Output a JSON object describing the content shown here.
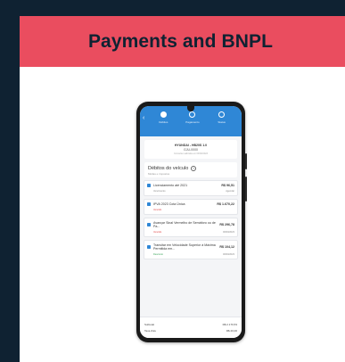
{
  "header": {
    "title": "Payments and BNPL"
  },
  "phone": {
    "steps": [
      {
        "label": "Débitos",
        "active": true
      },
      {
        "label": "Pagamento",
        "active": false
      },
      {
        "label": "Status",
        "active": false
      }
    ],
    "vehicle": {
      "name": "HYUNDAI - HB20S 1.0",
      "plate": "GJU-0000",
      "subtitle": "Consulta realizada em 00/00/2023"
    },
    "section": {
      "title": "Débitos do veículo",
      "subtitle": "Multas e impostos"
    },
    "debts": [
      {
        "title": "Licenciamento até 2021",
        "amount": "R$ 96,51",
        "meta_left": "Vencimento",
        "meta_left_color": "gray",
        "meta_right": "Agendar"
      },
      {
        "title": "IPVA 2023 Cota Única",
        "amount": "R$ 1.670,22",
        "meta_left": "Vencido",
        "meta_left_color": "red",
        "meta_right": ""
      },
      {
        "title": "Avançar Sinal Vermelho de Semáforo ou de Pa...",
        "amount": "R$ 296,78",
        "meta_left": "Vencido",
        "meta_left_color": "red",
        "meta_right": "00/00/2023"
      },
      {
        "title": "Transitar em Velocidade Superior à Máxima Permitida em...",
        "amount": "R$ 104,12",
        "meta_left": "Desconto",
        "meta_left_color": "green",
        "meta_right": "00/00/2023"
      }
    ],
    "totals": [
      {
        "label": "Subtotal",
        "value": "R$ 2.170,53"
      },
      {
        "label": "Taxa Zulu",
        "value": "R$ 20,00"
      }
    ]
  },
  "colors": {
    "background": "#0f2232",
    "header": "#ea4d5f",
    "app_blue": "#2f87d6"
  }
}
